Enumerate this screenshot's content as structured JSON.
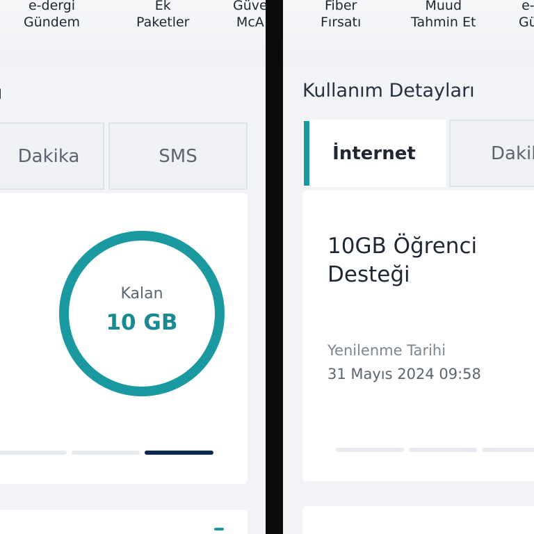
{
  "left_panel": {
    "nav": [
      {
        "line1": "e-dergi",
        "line2": "Gündem"
      },
      {
        "line1": "Ek",
        "line2": "Paketler"
      },
      {
        "line1": "Güve",
        "line2": "McA"
      }
    ],
    "title_fragment": "ı",
    "tabs": [
      {
        "label": "Dakika"
      },
      {
        "label": "SMS"
      }
    ],
    "ring": {
      "label": "Kalan",
      "value": "10 GB",
      "remaining_fraction": 1.0,
      "color": "#1a9aa0"
    },
    "slides": {
      "count": 3,
      "active_index": 2
    }
  },
  "right_panel": {
    "nav": [
      {
        "line1": "Fiber",
        "line2": "Fırsatı"
      },
      {
        "line1": "Muud",
        "line2": "Tahmin Et"
      },
      {
        "line1": "e-",
        "line2": "Gü"
      }
    ],
    "title": "Kullanım Detayları",
    "tabs": [
      {
        "label": "İnternet",
        "active": true
      },
      {
        "label": "Dakik",
        "active": false
      }
    ],
    "package": {
      "name_line1": "10GB Öğrenci",
      "name_line2": "Desteği",
      "renewal_label": "Yenilenme Tarihi",
      "renewal_date": "31 Mayıs 2024 09:58"
    },
    "slides": {
      "count": 3,
      "active_index": -1
    }
  },
  "colors": {
    "accent": "#1a9aa0",
    "active_indicator": "#0d2a4a",
    "background": "#f1f3f6"
  }
}
